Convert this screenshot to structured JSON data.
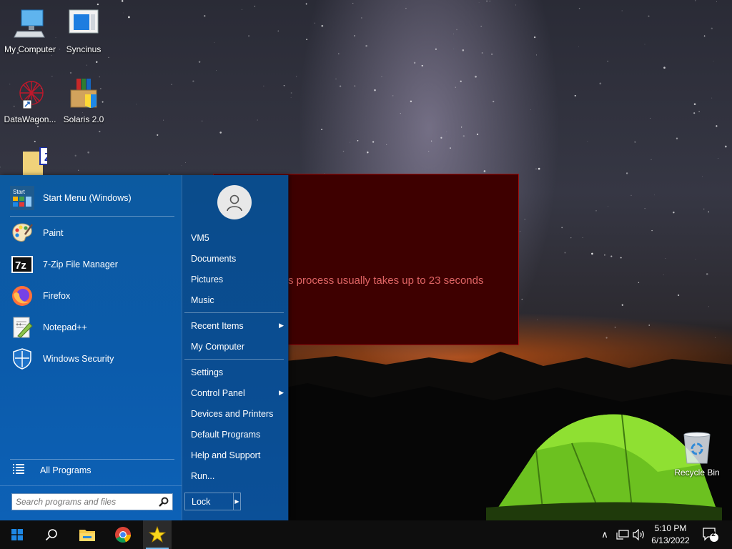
{
  "desktop": {
    "icons": [
      {
        "label": "My Computer",
        "icon": "computer-icon"
      },
      {
        "label": "Syncinus",
        "icon": "app-window-icon"
      },
      {
        "label": "DataWagon...",
        "icon": "fractal-shortcut-icon"
      },
      {
        "label": "Solaris 2.0",
        "icon": "installer-box-icon"
      },
      {
        "label": "",
        "icon": "zip-folder-icon"
      },
      {
        "label": "Recycle Bin",
        "icon": "recycle-bin-icon"
      }
    ]
  },
  "dialog": {
    "message": "s process usually takes up to 23 seconds"
  },
  "start_menu": {
    "pinned": [
      {
        "label": "Start Menu (Windows)",
        "icon": "start-menu-settings-icon"
      }
    ],
    "programs": [
      {
        "label": "Paint",
        "icon": "paint-palette-icon"
      },
      {
        "label": "7-Zip File Manager",
        "icon": "7zip-icon"
      },
      {
        "label": "Firefox",
        "icon": "firefox-icon"
      },
      {
        "label": "Notepad++",
        "icon": "notepad-plus-icon"
      },
      {
        "label": "Windows Security",
        "icon": "shield-icon"
      }
    ],
    "all_programs": "All Programs",
    "search_placeholder": "Search programs and files",
    "right_items": [
      {
        "label": "VM5"
      },
      {
        "label": "Documents"
      },
      {
        "label": "Pictures"
      },
      {
        "label": "Music"
      },
      {
        "label": "Recent Items",
        "submenu": true
      },
      {
        "label": "My Computer"
      },
      {
        "label": "Settings"
      },
      {
        "label": "Control Panel",
        "submenu": true
      },
      {
        "label": "Devices and Printers"
      },
      {
        "label": "Default Programs"
      },
      {
        "label": "Help and Support"
      },
      {
        "label": "Run..."
      }
    ],
    "lock_label": "Lock",
    "submenu_arrow": "▶"
  },
  "taskbar": {
    "items": [
      "windows-start-icon",
      "search-icon",
      "file-explorer-icon",
      "chrome-icon",
      "classic-start-star-icon"
    ],
    "tray": {
      "chevron": "∧",
      "time": "5:10 PM",
      "date": "6/13/2022",
      "notification_count": "2"
    }
  },
  "colors": {
    "start_menu_bg": "#0b5bab",
    "dialog_bg": "#3e0000",
    "dialog_text": "#e06464",
    "taskbar_bg": "#0e0e0e",
    "tent_green": "#7fd12a"
  }
}
